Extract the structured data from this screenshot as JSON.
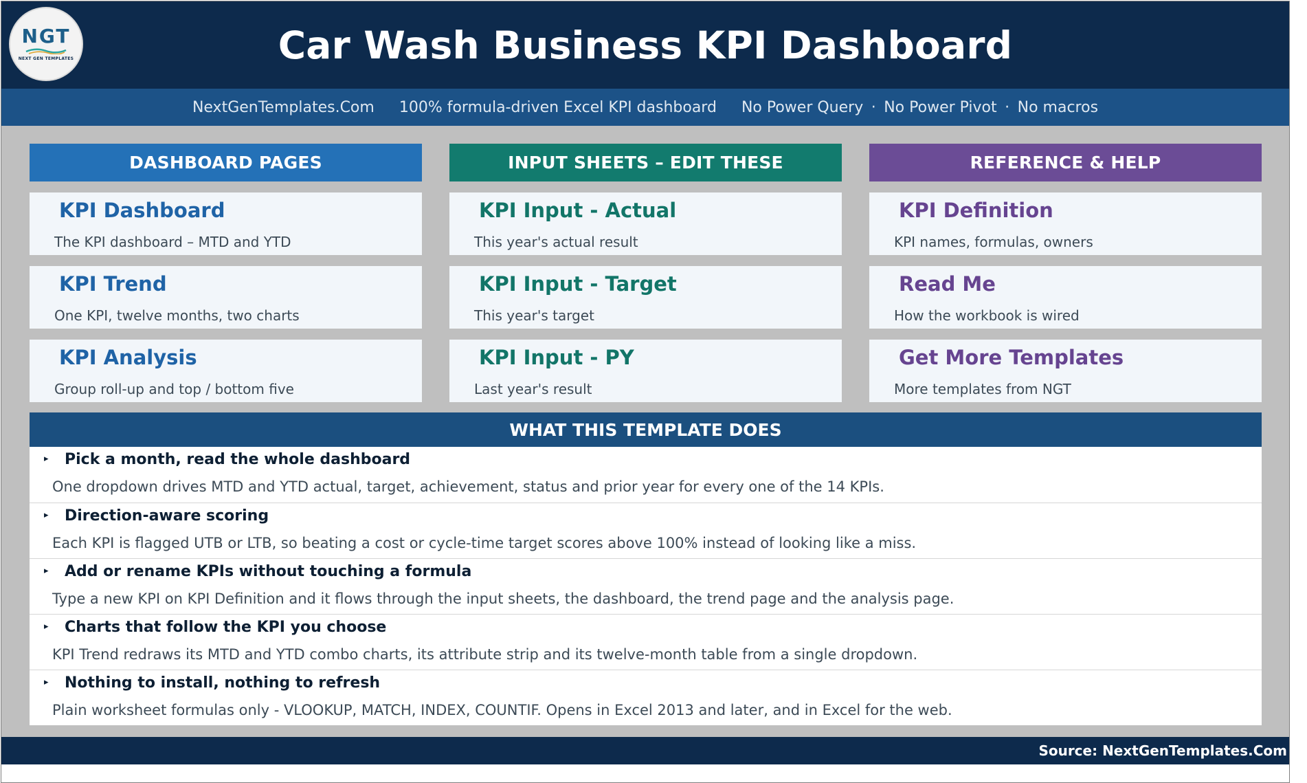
{
  "header": {
    "title": "Car Wash Business KPI Dashboard",
    "logo": {
      "mark": "NGT",
      "subtitle": "NEXT GEN TEMPLATES"
    }
  },
  "subbar": {
    "site": "NextGenTemplates.Com",
    "tagline": "100% formula-driven Excel KPI dashboard",
    "note1": "No Power Query",
    "note2": "No Power Pivot",
    "note3": "No macros",
    "separator": "·"
  },
  "columns": [
    {
      "heading": "DASHBOARD PAGES",
      "color": "#2471b7",
      "title_color": "#1f63a6",
      "items": [
        {
          "title": "KPI Dashboard",
          "desc": "The KPI dashboard – MTD and YTD"
        },
        {
          "title": "KPI Trend",
          "desc": "One KPI, twelve months, two charts"
        },
        {
          "title": "KPI Analysis",
          "desc": "Group roll-up and top / bottom five"
        }
      ]
    },
    {
      "heading": "INPUT SHEETS – EDIT THESE",
      "color": "#127b6e",
      "title_color": "#127568",
      "items": [
        {
          "title": "KPI Input - Actual",
          "desc": "This year's actual result"
        },
        {
          "title": "KPI Input - Target",
          "desc": "This year's target"
        },
        {
          "title": "KPI Input - PY",
          "desc": "Last year's result"
        }
      ]
    },
    {
      "heading": "REFERENCE & HELP",
      "color": "#6b4c96",
      "title_color": "#664490",
      "items": [
        {
          "title": "KPI Definition",
          "desc": "KPI names, formulas, owners"
        },
        {
          "title": "Read Me",
          "desc": "How the workbook is wired"
        },
        {
          "title": "Get More Templates",
          "desc": "More templates from NGT"
        }
      ]
    }
  ],
  "features": {
    "heading": "WHAT THIS TEMPLATE DOES",
    "bullet": "▸",
    "items": [
      {
        "title": "Pick a month, read the whole dashboard",
        "desc": "One dropdown drives MTD and YTD actual, target, achievement, status and prior year for every one of the 14 KPIs."
      },
      {
        "title": "Direction-aware scoring",
        "desc": "Each KPI is flagged UTB or LTB, so beating a cost or cycle-time target scores above 100% instead of looking like a miss."
      },
      {
        "title": "Add or rename KPIs without touching a formula",
        "desc": "Type a new KPI on KPI Definition and it flows through the input sheets, the dashboard, the trend page and the analysis page."
      },
      {
        "title": "Charts that follow the KPI you choose",
        "desc": "KPI Trend redraws its MTD and YTD combo charts, its attribute strip and its twelve-month table from a single dropdown."
      },
      {
        "title": "Nothing to install, nothing to refresh",
        "desc": "Plain worksheet formulas only - VLOOKUP, MATCH, INDEX, COUNTIF. Opens in Excel 2013 and later, and in Excel for the web."
      }
    ]
  },
  "footer": {
    "source": "Source: NextGenTemplates.Com"
  },
  "colors": {
    "navy": "#0d2a4c",
    "subbar": "#1c5287",
    "features_head": "#1b4f7f",
    "sheet_bg": "#bfbfbf"
  }
}
